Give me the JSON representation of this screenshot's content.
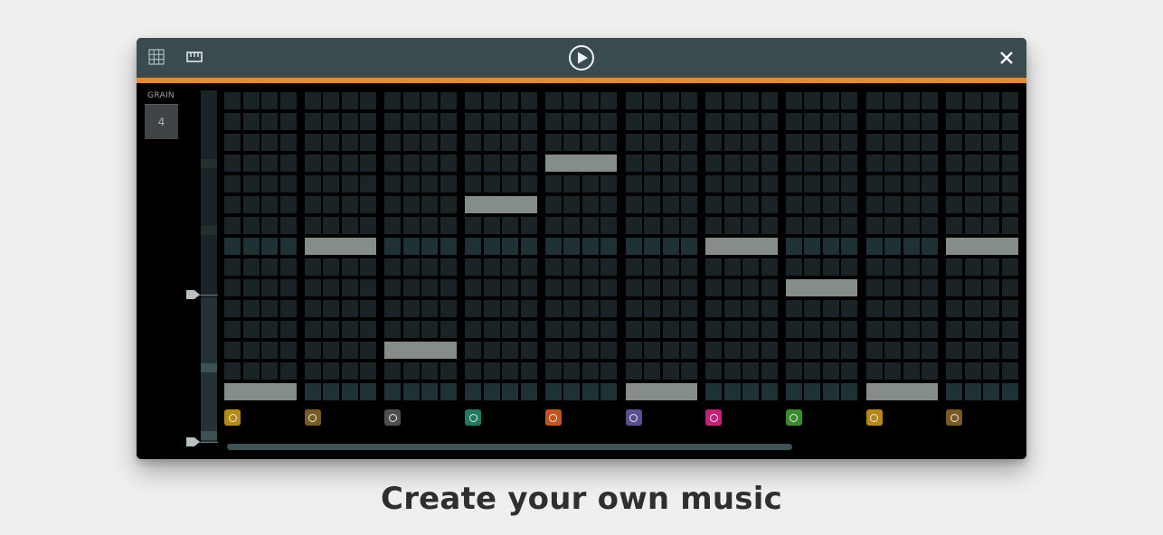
{
  "toolbar": {
    "grid_icon": "grid-icon",
    "keyboard_icon": "keyboard-icon",
    "play_icon": "play-icon",
    "close_icon": "close-icon",
    "background": "#3a4b50",
    "accent": "#f08a24"
  },
  "grain": {
    "label": "GRAIN",
    "value": "4"
  },
  "sequencer": {
    "columns": 10,
    "steps_per_column": 4,
    "rows": 15,
    "highlight_rows": [
      7,
      14
    ],
    "notes": [
      {
        "column": 0,
        "row": 14
      },
      {
        "column": 1,
        "row": 7
      },
      {
        "column": 2,
        "row": 12
      },
      {
        "column": 3,
        "row": 5
      },
      {
        "column": 4,
        "row": 3
      },
      {
        "column": 5,
        "row": 14
      },
      {
        "column": 6,
        "row": 7
      },
      {
        "column": 7,
        "row": 9
      },
      {
        "column": 8,
        "row": 14
      },
      {
        "column": 9,
        "row": 7
      }
    ],
    "instrument_colors": [
      "#b58a14",
      "#7a5a22",
      "#4e4e4e",
      "#1f7a60",
      "#c4541e",
      "#5a4f8e",
      "#c1237a",
      "#3c8a2e",
      "#b58a14",
      "#7a5a22"
    ]
  },
  "caption": "Create your own music"
}
